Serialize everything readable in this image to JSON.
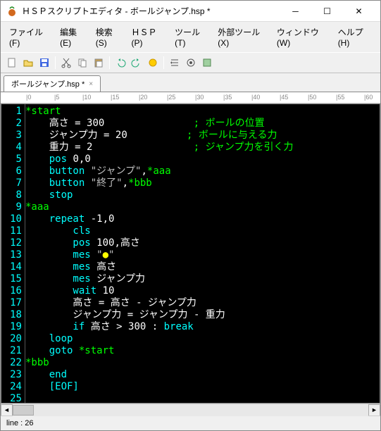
{
  "window": {
    "title": "ＨＳＰスクリプトエディタ - ボールジャンプ.hsp *"
  },
  "menu": {
    "file": "ファイル(F)",
    "edit": "編集(E)",
    "search": "検索(S)",
    "hsp": "ＨＳＰ(P)",
    "tools": "ツール(T)",
    "ext": "外部ツール(X)",
    "window": "ウィンドウ(W)",
    "help": "ヘルプ(H)"
  },
  "tab": {
    "label": "ボールジャンプ.hsp *"
  },
  "ruler": {
    "marks": [
      "|0",
      "|5",
      "|10",
      "|15",
      "|20",
      "|25",
      "|30",
      "|35",
      "|40",
      "|45",
      "|50",
      "|55",
      "|60"
    ]
  },
  "code": {
    "lines": [
      {
        "n": 1,
        "seg": [
          {
            "c": "lbl",
            "t": "*start"
          }
        ]
      },
      {
        "n": 2,
        "seg": [
          {
            "c": "id",
            "t": "    高さ "
          },
          {
            "c": "num",
            "t": "= 300"
          },
          {
            "c": "id",
            "t": "               "
          },
          {
            "c": "cmt",
            "t": "; ボールの位置"
          }
        ]
      },
      {
        "n": 3,
        "seg": [
          {
            "c": "id",
            "t": "    ジャンプ力 "
          },
          {
            "c": "num",
            "t": "= 20"
          },
          {
            "c": "id",
            "t": "          "
          },
          {
            "c": "cmt",
            "t": "; ボールに与える力"
          }
        ]
      },
      {
        "n": 4,
        "seg": [
          {
            "c": "id",
            "t": "    重力 "
          },
          {
            "c": "num",
            "t": "= 2"
          },
          {
            "c": "id",
            "t": "                 "
          },
          {
            "c": "cmt",
            "t": "; ジャンプ力を引く力"
          }
        ]
      },
      {
        "n": 5,
        "seg": [
          {
            "c": "kw",
            "t": "    pos "
          },
          {
            "c": "num",
            "t": "0"
          },
          {
            "c": "id",
            "t": ","
          },
          {
            "c": "num",
            "t": "0"
          }
        ]
      },
      {
        "n": 6,
        "seg": [
          {
            "c": "kw",
            "t": "    button "
          },
          {
            "c": "str",
            "t": "\"ジャンプ\""
          },
          {
            "c": "id",
            "t": ","
          },
          {
            "c": "lbl",
            "t": "*aaa"
          }
        ]
      },
      {
        "n": 7,
        "seg": [
          {
            "c": "kw",
            "t": "    button "
          },
          {
            "c": "str",
            "t": "\"終了\""
          },
          {
            "c": "id",
            "t": ","
          },
          {
            "c": "lbl",
            "t": "*bbb"
          }
        ]
      },
      {
        "n": 8,
        "seg": [
          {
            "c": "kw",
            "t": "    stop"
          }
        ]
      },
      {
        "n": 9,
        "seg": [
          {
            "c": "id",
            "t": ""
          }
        ]
      },
      {
        "n": 10,
        "seg": [
          {
            "c": "lbl",
            "t": "*aaa"
          }
        ]
      },
      {
        "n": 11,
        "seg": [
          {
            "c": "kw",
            "t": "    repeat "
          },
          {
            "c": "num",
            "t": "-1"
          },
          {
            "c": "id",
            "t": ","
          },
          {
            "c": "num",
            "t": "0"
          }
        ]
      },
      {
        "n": 12,
        "seg": [
          {
            "c": "kw",
            "t": "        cls"
          }
        ]
      },
      {
        "n": 13,
        "seg": [
          {
            "c": "kw",
            "t": "        pos "
          },
          {
            "c": "num",
            "t": "100"
          },
          {
            "c": "id",
            "t": ",高さ"
          }
        ]
      },
      {
        "n": 14,
        "seg": [
          {
            "c": "kw",
            "t": "        mes "
          },
          {
            "c": "str",
            "t": "\""
          },
          {
            "c": "bullet",
            "t": "●"
          },
          {
            "c": "str",
            "t": "\""
          }
        ]
      },
      {
        "n": 15,
        "seg": [
          {
            "c": "kw",
            "t": "        mes "
          },
          {
            "c": "id",
            "t": "高さ"
          }
        ]
      },
      {
        "n": 16,
        "seg": [
          {
            "c": "kw",
            "t": "        mes "
          },
          {
            "c": "id",
            "t": "ジャンプ力"
          }
        ]
      },
      {
        "n": 17,
        "seg": [
          {
            "c": "kw",
            "t": "        wait "
          },
          {
            "c": "num",
            "t": "10"
          }
        ]
      },
      {
        "n": 18,
        "seg": [
          {
            "c": "id",
            "t": "        高さ "
          },
          {
            "c": "num",
            "t": "="
          },
          {
            "c": "id",
            "t": " 高さ "
          },
          {
            "c": "num",
            "t": "-"
          },
          {
            "c": "id",
            "t": " ジャンプ力"
          }
        ]
      },
      {
        "n": 19,
        "seg": [
          {
            "c": "id",
            "t": "        ジャンプ力 "
          },
          {
            "c": "num",
            "t": "="
          },
          {
            "c": "id",
            "t": " ジャンプ力 "
          },
          {
            "c": "num",
            "t": "-"
          },
          {
            "c": "id",
            "t": " 重力"
          }
        ]
      },
      {
        "n": 20,
        "seg": [
          {
            "c": "kw",
            "t": "        if "
          },
          {
            "c": "id",
            "t": "高さ "
          },
          {
            "c": "num",
            "t": "> 300 "
          },
          {
            "c": "id",
            "t": ": "
          },
          {
            "c": "kw",
            "t": "break"
          }
        ]
      },
      {
        "n": 21,
        "seg": [
          {
            "c": "kw",
            "t": "    loop"
          }
        ]
      },
      {
        "n": 22,
        "seg": [
          {
            "c": "kw",
            "t": "    goto "
          },
          {
            "c": "lbl",
            "t": "*start"
          }
        ]
      },
      {
        "n": 23,
        "seg": [
          {
            "c": "id",
            "t": ""
          }
        ]
      },
      {
        "n": 24,
        "seg": [
          {
            "c": "lbl",
            "t": "*bbb"
          }
        ]
      },
      {
        "n": 25,
        "seg": [
          {
            "c": "kw",
            "t": "    end"
          }
        ]
      },
      {
        "n": 26,
        "seg": [
          {
            "c": "eof",
            "t": "    [EOF]"
          }
        ],
        "current": true
      }
    ]
  },
  "status": {
    "line": "line : 26"
  }
}
